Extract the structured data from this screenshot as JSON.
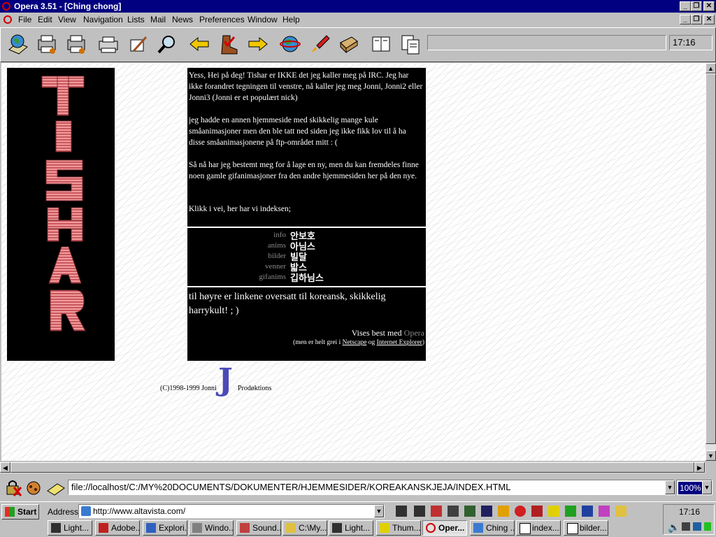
{
  "window": {
    "title": "Opera 3.51 - [Ching chong]"
  },
  "menu": [
    "File",
    "Edit",
    "View",
    "Navigation",
    "Lists",
    "Mail",
    "News",
    "Preferences",
    "Window",
    "Help"
  ],
  "toolbar": {
    "icons": [
      "globe-home-icon",
      "print-icon",
      "print-preview-icon",
      "printer-icon",
      "compose-icon",
      "search-icon",
      "back-arrow-icon",
      "boot-icon",
      "forward-arrow-icon",
      "world-icon",
      "rocket-icon",
      "hotlist-icon",
      "book-icon",
      "pages-icon"
    ],
    "time": "17:16"
  },
  "page": {
    "para1": "Yess, Hei på deg! Tishar er IKKE det jeg kaller meg på IRC. Jeg har ikke forandret tegningen til venstre, nå kaller jeg meg Jonni, Jonni2 eller Jonni3 (Jonni er et populært nick)",
    "para2": "jeg hadde en annen hjemmeside med skikkelig mange kule småanimasjoner men den ble tatt ned siden jeg ikke fikk lov til å ha disse småanimasjonene på ftp-området mitt : (",
    "para3": "Så nå har jeg bestemt meg for å lage en ny, men du kan fremdeles finne noen gamle gifanimasjoner fra den andre hjemmesiden her på den nye.",
    "para4": "Klikk i vei, her har vi indeksen;",
    "nav": [
      {
        "label": "info",
        "korean": "안보호"
      },
      {
        "label": "anims",
        "korean": "아님스"
      },
      {
        "label": "bilder",
        "korean": "빌달"
      },
      {
        "label": "venner",
        "korean": "밟스"
      },
      {
        "label": "gifanims",
        "korean": "깁하님스"
      }
    ],
    "para5": "til høyre er linkene oversatt til koreansk, skikkelig harrykult! ; )",
    "best_viewed": "Vises best med",
    "opera_link": "Opera",
    "browser_note_pre": "(men er helt grei i",
    "netscape": "Netscape",
    "og": "og",
    "ie": "Internet Explorer",
    "browser_note_post": ")",
    "footer_copy": "(C)1998-1999 Jonni",
    "footer_j": "J",
    "footer_prod": "Prodøktions"
  },
  "address": {
    "url": "file://localhost/C:/MY%20DOCUMENTS/DOKUMENTER/HJEMMESIDER/KOREAKANSKJEJA/INDEX.HTML",
    "zoom": "100%"
  },
  "taskbar": {
    "start": "Start",
    "address_label": "Address",
    "address_value": "http://www.altavista.com/",
    "clock": "17:16",
    "buttons": [
      "Light...",
      "Adobe...",
      "Explori...",
      "Windo...",
      "Sound...",
      "C:\\My...",
      "Light...",
      "Thum...",
      "Oper...",
      "Ching ...",
      "index....",
      "bilder...."
    ]
  },
  "colors": {
    "titlebar": "#000080",
    "logo_pink": "#e8787c",
    "accent_red": "#d00000"
  }
}
